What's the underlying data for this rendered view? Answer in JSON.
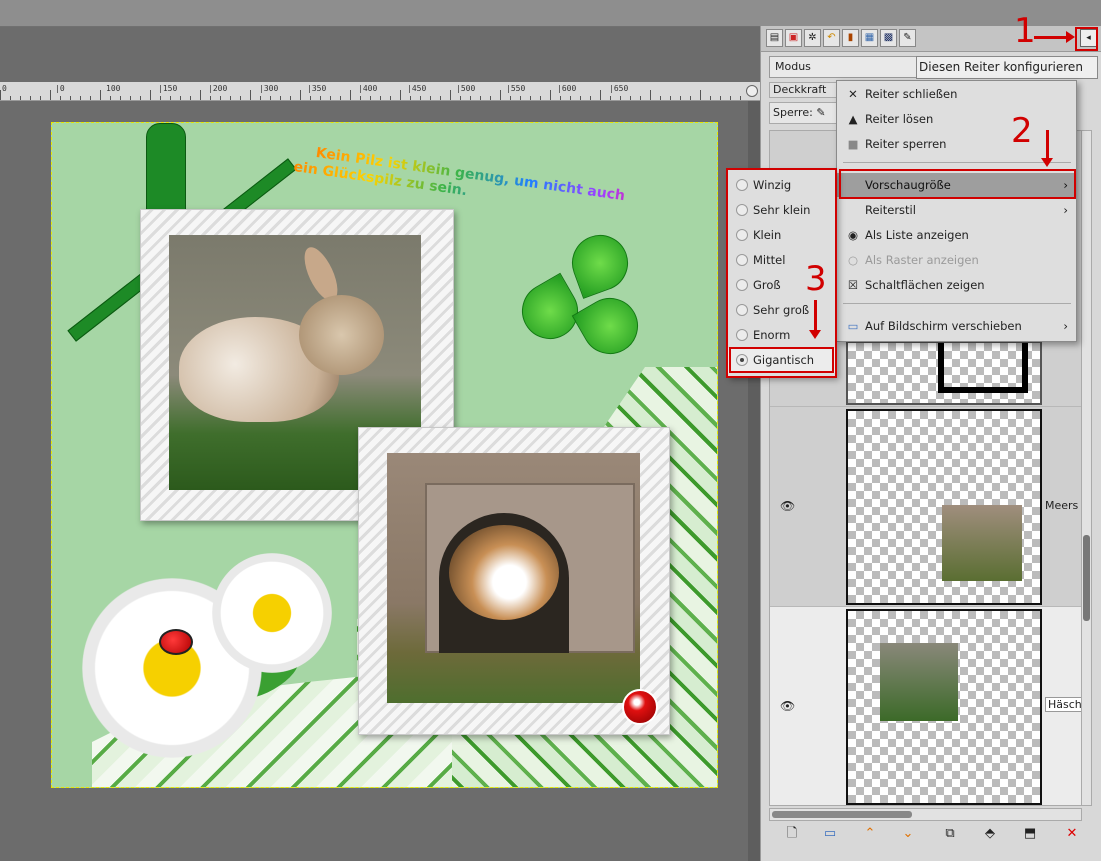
{
  "canvas": {
    "ruler_labels": [
      "0",
      "|0",
      "100",
      "|150",
      "|200",
      "|300",
      "|350",
      "|400",
      "|450",
      "|500",
      "|550",
      "|600",
      "|650"
    ],
    "artwork_text_line1": "Kein Pilz ist klein genug, um nicht auch",
    "artwork_text_line2": "ein Glückspilz zu sein."
  },
  "dock": {
    "mode_label": "Modus",
    "tooltip": "Diesen Reiter konfigurieren",
    "opacity_label": "Deckkraft",
    "lock_label": "Sperre:",
    "layers": [
      {
        "name": "Meers",
        "visible": true
      },
      {
        "name": "Häsch",
        "visible": true
      }
    ]
  },
  "context_menu": {
    "items": [
      {
        "label": "Reiter schließen",
        "icon": "close-icon",
        "enabled": true
      },
      {
        "label": "Reiter lösen",
        "icon": "detach-icon",
        "enabled": true
      },
      {
        "label": "Reiter sperren",
        "icon": "lock-box-icon",
        "enabled": true
      },
      {
        "label": "Vorschaugröße",
        "icon": "",
        "enabled": true,
        "submenu": true
      },
      {
        "label": "Reiterstil",
        "icon": "",
        "enabled": true,
        "submenu": true
      },
      {
        "label": "Als Liste anzeigen",
        "icon": "radio-on-icon",
        "enabled": true
      },
      {
        "label": "Als Raster anzeigen",
        "icon": "radio-off-icon",
        "enabled": false
      },
      {
        "label": "Schaltflächen zeigen",
        "icon": "checkbox-checked-icon",
        "enabled": true
      },
      {
        "label": "Auf Bildschirm verschieben",
        "icon": "screen-icon",
        "enabled": true,
        "submenu": true
      }
    ]
  },
  "preview_size_menu": {
    "options": [
      "Winzig",
      "Sehr klein",
      "Klein",
      "Mittel",
      "Groß",
      "Sehr groß",
      "Enorm",
      "Gigantisch"
    ],
    "selected": "Gigantisch"
  },
  "annotations": {
    "step1": "1",
    "step2": "2",
    "step3": "3"
  },
  "colors": {
    "annotation": "#d10000",
    "menu_highlight": "#9e9e9e"
  }
}
